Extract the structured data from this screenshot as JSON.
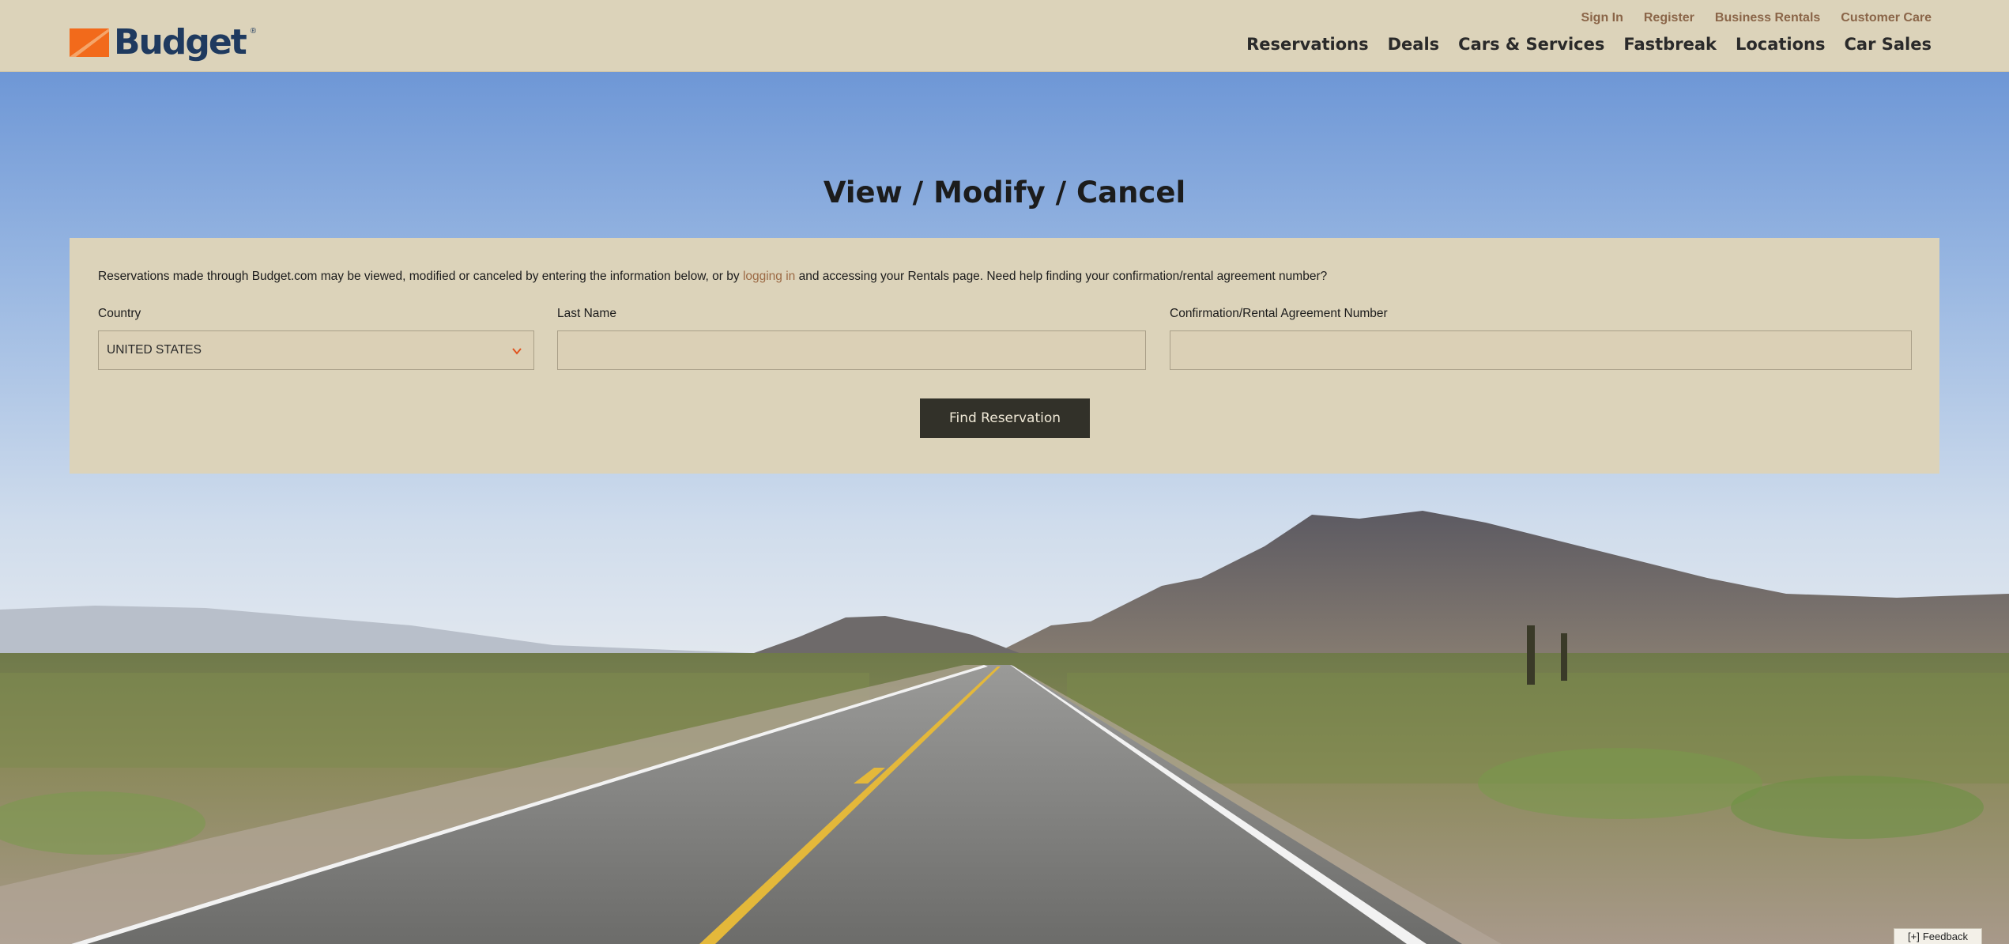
{
  "header": {
    "logo_text": "Budget",
    "logo_mark": "®",
    "brand_colors": {
      "orange": "#f26a1b",
      "navy": "#1f3a5f"
    },
    "utility_links": [
      "Sign In",
      "Register",
      "Business Rentals",
      "Customer Care"
    ],
    "main_nav": [
      "Reservations",
      "Deals",
      "Cars & Services",
      "Fastbreak",
      "Locations",
      "Car Sales"
    ]
  },
  "page": {
    "title": "View / Modify / Cancel"
  },
  "form": {
    "intro_before": "Reservations made through Budget.com may be viewed, modified or canceled by entering the information below, or by ",
    "intro_link": "logging in",
    "intro_after": " and accessing your Rentals page. Need help finding your confirmation/rental agreement number?",
    "country_label": "Country",
    "country_value": "UNITED STATES",
    "last_name_label": "Last Name",
    "last_name_value": "",
    "confirmation_label": "Confirmation/Rental Agreement Number",
    "confirmation_value": "",
    "submit_label": "Find Reservation"
  },
  "feedback": {
    "label": "Feedback",
    "icon": "feedback-icon"
  }
}
